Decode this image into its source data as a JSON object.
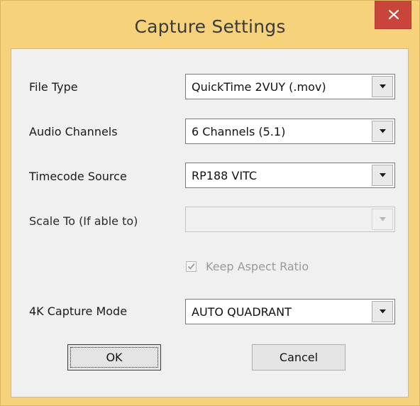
{
  "window": {
    "title": "Capture Settings",
    "close_icon": "close-icon",
    "title_bar_color": "#f6d37a",
    "close_button_color": "#c9453a"
  },
  "fields": {
    "file_type": {
      "label": "File Type",
      "value": "QuickTime 2VUY (.mov)"
    },
    "audio_channels": {
      "label": "Audio Channels",
      "value": "6 Channels (5.1)"
    },
    "timecode_source": {
      "label": "Timecode Source",
      "value": "RP188 VITC"
    },
    "scale_to": {
      "label": "Scale To (If able to)",
      "value": "",
      "enabled": false
    },
    "keep_aspect_ratio": {
      "label": "Keep Aspect Ratio",
      "checked": true,
      "enabled": false
    },
    "capture_mode_4k": {
      "label": "4K Capture Mode",
      "value": "AUTO QUADRANT"
    }
  },
  "buttons": {
    "ok": "OK",
    "cancel": "Cancel"
  }
}
